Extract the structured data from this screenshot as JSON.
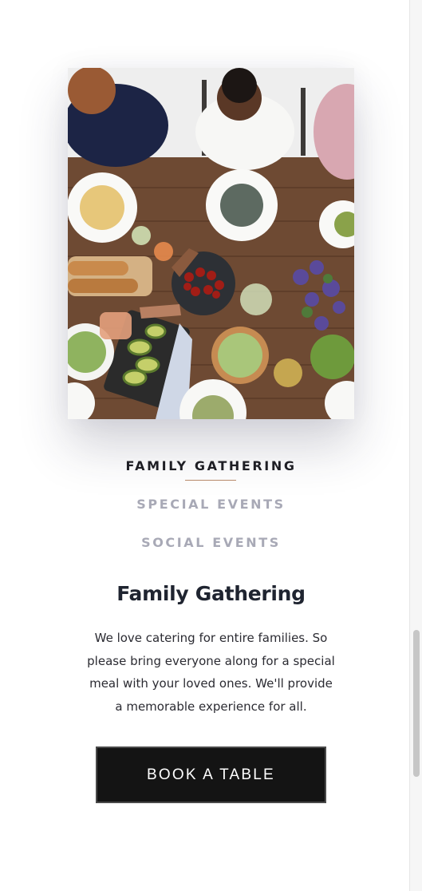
{
  "tabs": [
    {
      "label": "FAMILY GATHERING",
      "active": true
    },
    {
      "label": "SPECIAL EVENTS",
      "active": false
    },
    {
      "label": "SOCIAL EVENTS",
      "active": false
    }
  ],
  "section": {
    "title": "Family Gathering",
    "description": "We love catering for entire families. So please bring everyone along for a special meal with your loved ones. We'll provide a memorable experience for all."
  },
  "cta": {
    "label": "BOOK A TABLE"
  },
  "colors": {
    "active_tab": "#1e1e24",
    "inactive_tab": "#a8a9b6",
    "underline_accent": "#b88a6a",
    "button_bg": "#141414"
  }
}
